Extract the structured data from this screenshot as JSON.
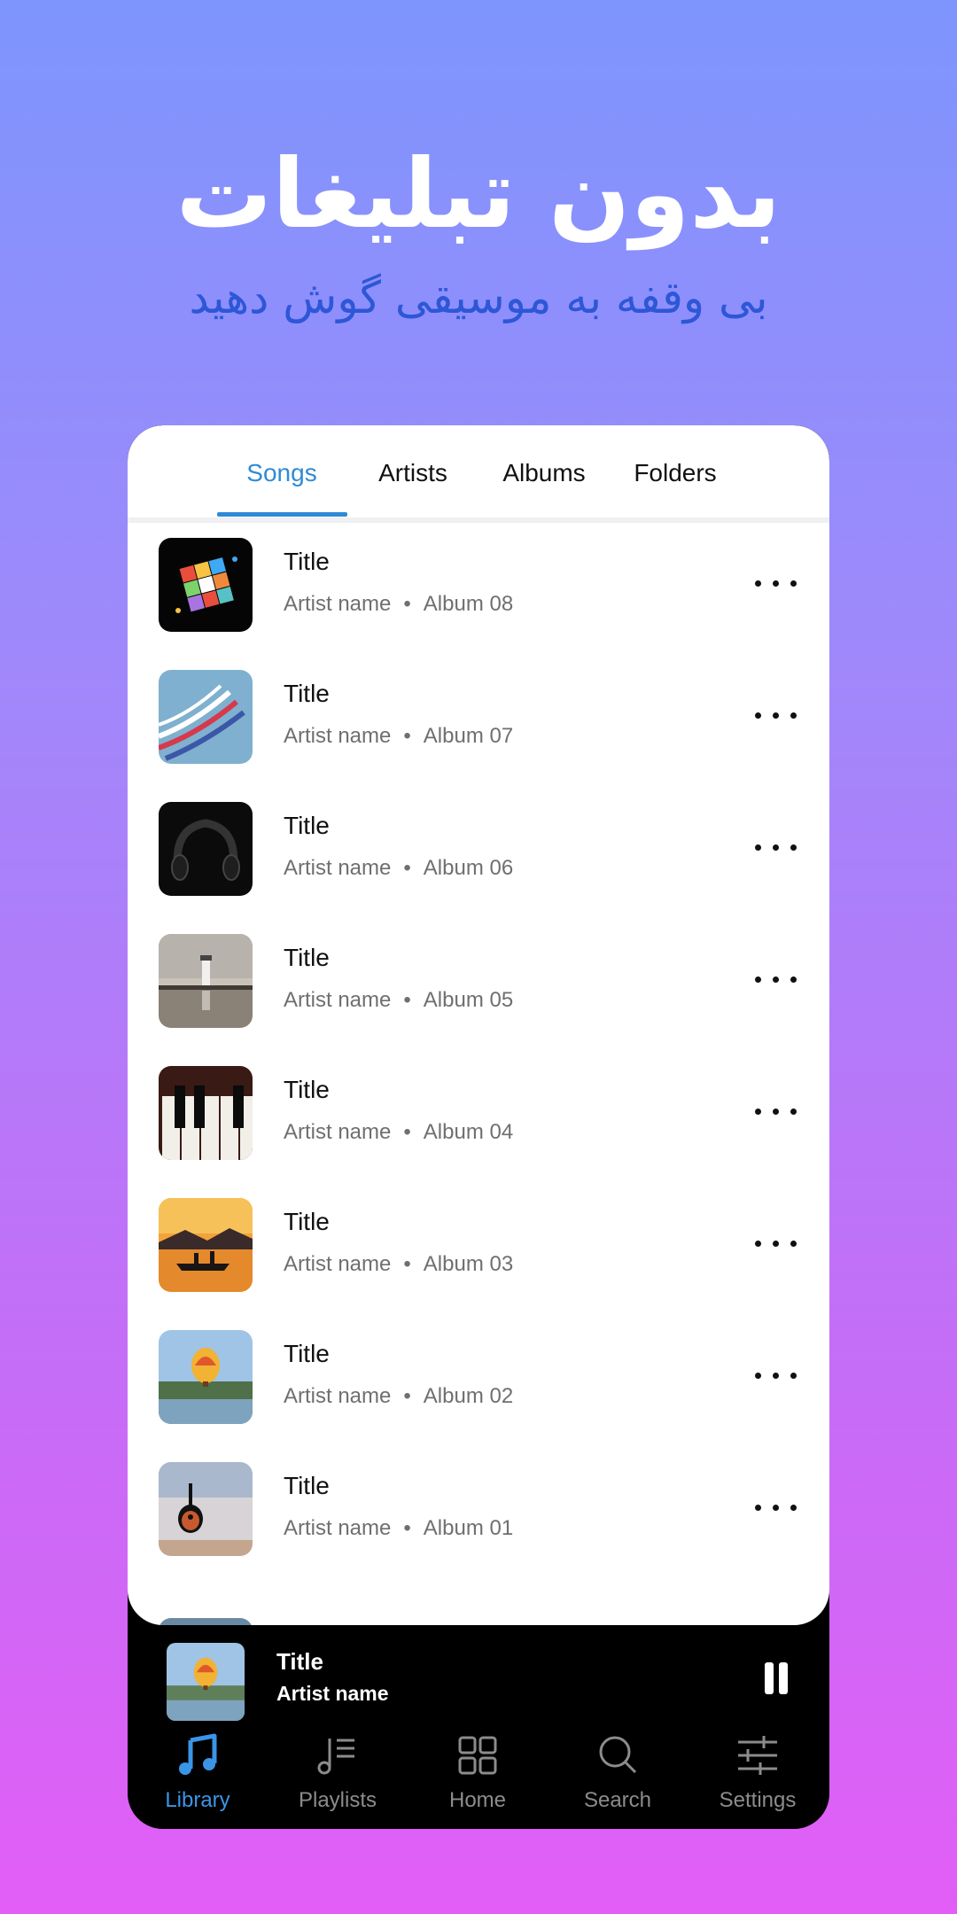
{
  "hero": {
    "title": "بدون تبلیغات",
    "subtitle": "بی وقفه به موسیقی گوش دهید"
  },
  "tabs": [
    {
      "label": "Songs",
      "active": true
    },
    {
      "label": "Artists",
      "active": false
    },
    {
      "label": "Albums",
      "active": false
    },
    {
      "label": "Folders",
      "active": false
    }
  ],
  "songs": [
    {
      "title": "Title",
      "artist": "Artist name",
      "album": "Album 08",
      "thumb": "rubiks-cube"
    },
    {
      "title": "Title",
      "artist": "Artist name",
      "album": "Album 07",
      "thumb": "jets-smoke"
    },
    {
      "title": "Title",
      "artist": "Artist name",
      "album": "Album 06",
      "thumb": "headphones"
    },
    {
      "title": "Title",
      "artist": "Artist name",
      "album": "Album 05",
      "thumb": "lighthouse"
    },
    {
      "title": "Title",
      "artist": "Artist name",
      "album": "Album 04",
      "thumb": "piano-keys"
    },
    {
      "title": "Title",
      "artist": "Artist name",
      "album": "Album 03",
      "thumb": "sunset-boat"
    },
    {
      "title": "Title",
      "artist": "Artist name",
      "album": "Album 02",
      "thumb": "hot-air-balloon"
    },
    {
      "title": "Title",
      "artist": "Artist name",
      "album": "Album 01",
      "thumb": "guitar"
    }
  ],
  "separator": "•",
  "now_playing": {
    "title": "Title",
    "artist": "Artist name",
    "thumb": "hot-air-balloon"
  },
  "nav": [
    {
      "label": "Library",
      "icon": "music-note-icon",
      "active": true
    },
    {
      "label": "Playlists",
      "icon": "playlist-icon",
      "active": false
    },
    {
      "label": "Home",
      "icon": "grid-icon",
      "active": false
    },
    {
      "label": "Search",
      "icon": "search-icon",
      "active": false
    },
    {
      "label": "Settings",
      "icon": "sliders-icon",
      "active": false
    }
  ],
  "colors": {
    "accent": "#2f8ad6",
    "nav_active": "#3a95e6",
    "subtitle": "#2d57d6"
  }
}
